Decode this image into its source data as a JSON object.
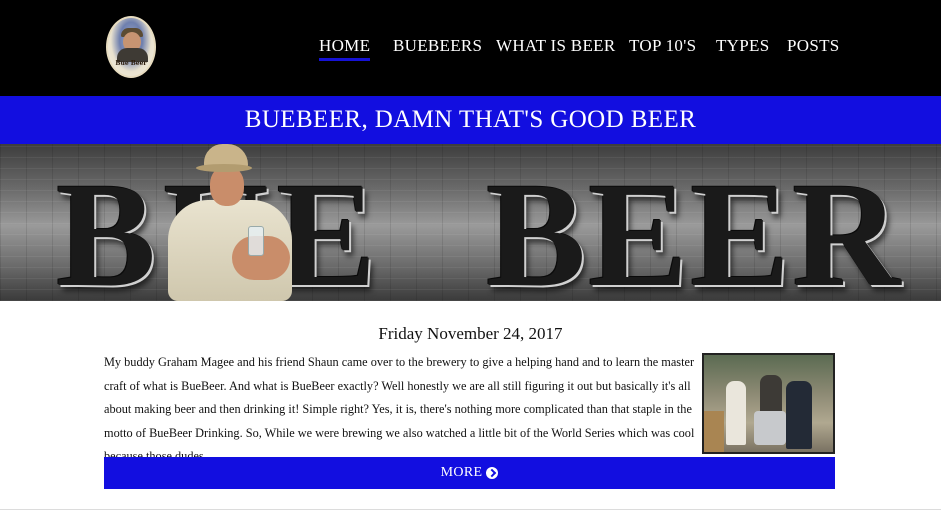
{
  "header": {
    "logo_text": "Bue Beer",
    "nav": [
      {
        "label": "HOME",
        "active": true
      },
      {
        "label": "BUEBEERS",
        "active": false
      },
      {
        "label": "WHAT IS BEER",
        "active": false
      },
      {
        "label": "TOP 10'S",
        "active": false
      },
      {
        "label": "TYPES",
        "active": false
      },
      {
        "label": "POSTS",
        "active": false
      }
    ]
  },
  "banner": {
    "title": "BUEBEER, DAMN THAT'S GOOD BEER"
  },
  "hero": {
    "word1": "BUE",
    "word2": "BEER"
  },
  "post": {
    "date": "Friday November 24, 2017",
    "excerpt": "My buddy Graham Magee and his friend Shaun came over to the brewery to give a helping hand and to learn the master craft of what is BueBeer. And what is BueBeer exactly? Well honestly we are all still figuring it out but basically it's all about making beer and then drinking it! Simple right? Yes, it is, there's nothing more complicated than that staple in the motto of BueBeer Drinking. So, While we were brewing we also watched a little bit of the World Series which was cool because those dudes ...",
    "more_label": "MORE"
  },
  "colors": {
    "accent": "#120ee0",
    "header_bg": "#000000"
  },
  "icons": {
    "more_arrow": "circle-arrow-right-icon"
  }
}
